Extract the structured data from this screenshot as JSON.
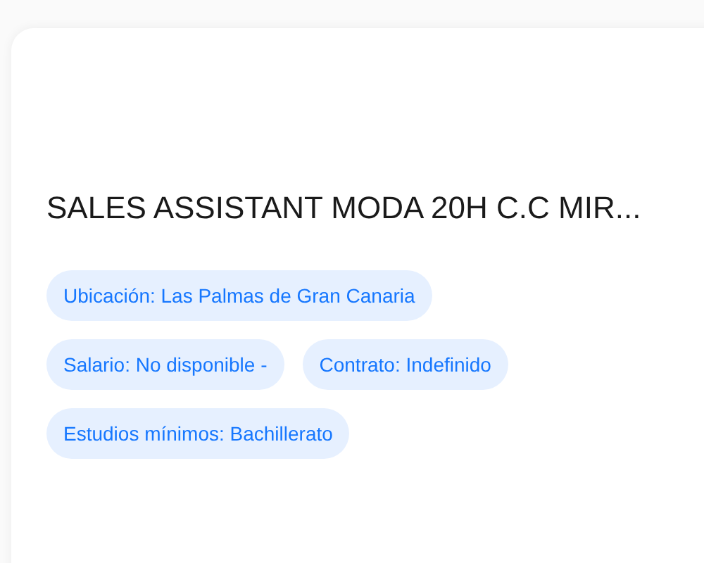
{
  "job": {
    "title": "SALES ASSISTANT MODA 20H C.C MIR...",
    "tags": [
      {
        "label": "Ubicación: Las Palmas de Gran Canaria"
      },
      {
        "label": "Salario: No disponible -"
      },
      {
        "label": "Contrato: Indefinido"
      },
      {
        "label": "Estudios mínimos: Bachillerato"
      }
    ]
  }
}
